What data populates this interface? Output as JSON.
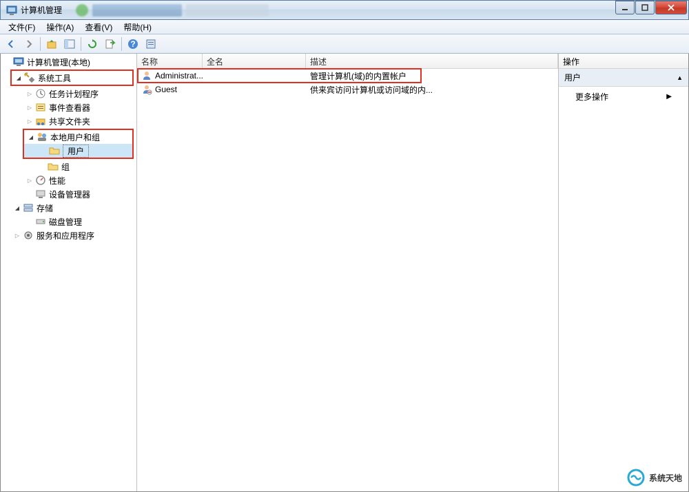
{
  "titlebar": {
    "title": "计算机管理"
  },
  "menu": {
    "file": "文件(F)",
    "action": "操作(A)",
    "view": "查看(V)",
    "help": "帮助(H)"
  },
  "tree": {
    "root": "计算机管理(本地)",
    "system_tools": "系统工具",
    "task_scheduler": "任务计划程序",
    "event_viewer": "事件查看器",
    "shared_folders": "共享文件夹",
    "local_users_groups": "本地用户和组",
    "users": "用户",
    "groups": "组",
    "performance": "性能",
    "device_manager": "设备管理器",
    "storage": "存储",
    "disk_management": "磁盘管理",
    "services_apps": "服务和应用程序"
  },
  "list": {
    "columns": {
      "name": "名称",
      "fullname": "全名",
      "description": "描述"
    },
    "rows": [
      {
        "name": "Administrat...",
        "fullname": "",
        "description": "管理计算机(域)的内置帐户"
      },
      {
        "name": "Guest",
        "fullname": "",
        "description": "供来宾访问计算机或访问域的内..."
      }
    ]
  },
  "actions": {
    "header": "操作",
    "section": "用户",
    "more": "更多操作"
  },
  "watermark": "系统天地"
}
